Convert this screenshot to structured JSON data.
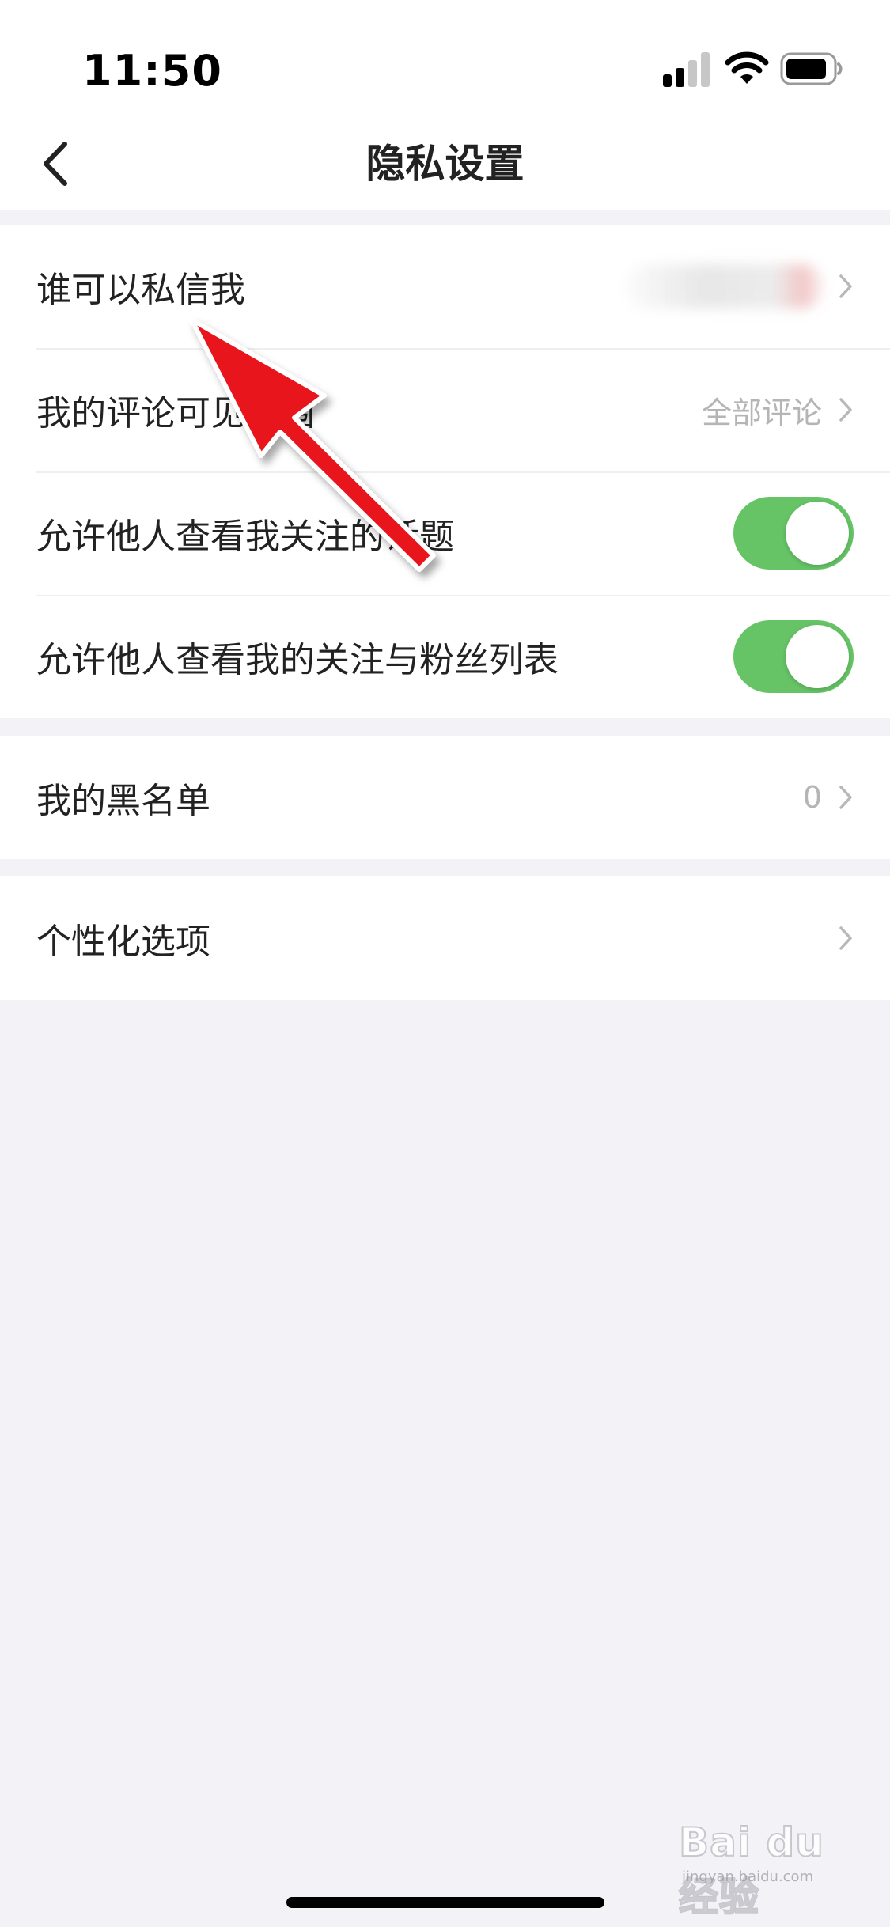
{
  "status_bar": {
    "time": "11:50"
  },
  "nav": {
    "title": "隐私设置",
    "back_icon": "chevron-left-icon"
  },
  "privacy_group": {
    "who_can_message": {
      "label": "谁可以私信我",
      "value_blurred": true
    },
    "comment_visibility": {
      "label": "我的评论可见范围",
      "value": "全部评论"
    },
    "show_followed_topics": {
      "label": "允许他人查看我关注的话题",
      "enabled": true
    },
    "show_follow_lists": {
      "label": "允许他人查看我的关注与粉丝列表",
      "enabled": true
    }
  },
  "blacklist": {
    "label": "我的黑名单",
    "count": "0"
  },
  "personalization": {
    "label": "个性化选项"
  },
  "watermark": {
    "logo": "Bai du 经验",
    "url": "jingyan.baidu.com"
  },
  "colors": {
    "toggle_on": "#66c466",
    "background": "#f2f2f7",
    "annotation_arrow": "#e8141b"
  }
}
